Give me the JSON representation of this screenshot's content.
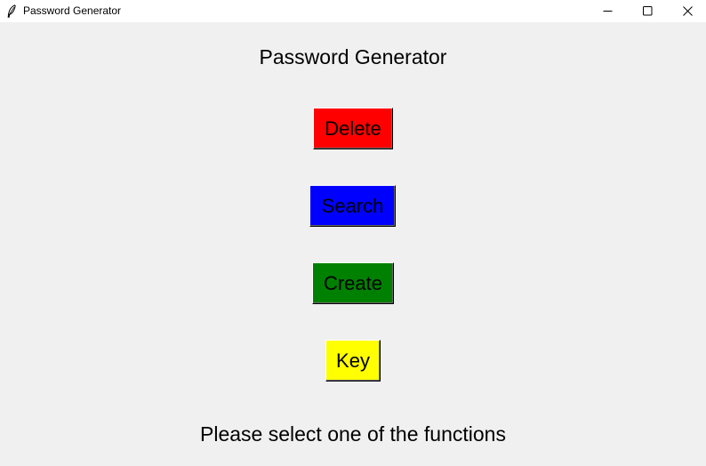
{
  "window": {
    "title": "Password Generator",
    "app_icon": "feather-icon",
    "controls": {
      "minimize_icon": "minimize-icon",
      "maximize_icon": "maximize-icon",
      "close_icon": "close-icon"
    }
  },
  "main": {
    "heading": "Password Generator",
    "buttons": [
      {
        "label": "Delete",
        "color": "#ff0000"
      },
      {
        "label": "Search",
        "color": "#0000ff"
      },
      {
        "label": "Create",
        "color": "#008000"
      },
      {
        "label": "Key",
        "color": "#ffff00"
      }
    ],
    "status": "Please select one of the functions"
  }
}
